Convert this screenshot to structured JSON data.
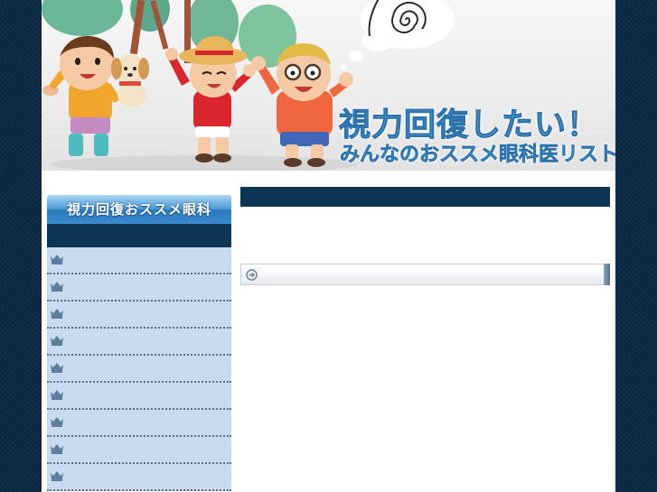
{
  "header": {
    "title": "視力回復したい！",
    "subtitle": "みんなのおススメ眼科医リスト"
  },
  "sidebar": {
    "heading": "視力回復おススメ眼科",
    "item_icon": "crown-icon",
    "items": [
      {
        "label": ""
      },
      {
        "label": ""
      },
      {
        "label": ""
      },
      {
        "label": ""
      },
      {
        "label": ""
      },
      {
        "label": ""
      },
      {
        "label": ""
      },
      {
        "label": ""
      },
      {
        "label": ""
      }
    ]
  },
  "main": {
    "heading": "",
    "subheading_icon": "arrow-circle-icon",
    "subheading": ""
  },
  "colors": {
    "page_background": "#0b2a44",
    "navy_bar": "#0d3656",
    "sidebar_list": "#c9dbee",
    "heading_blue": "#3b8ad0",
    "title_text": "#5da6dc"
  }
}
